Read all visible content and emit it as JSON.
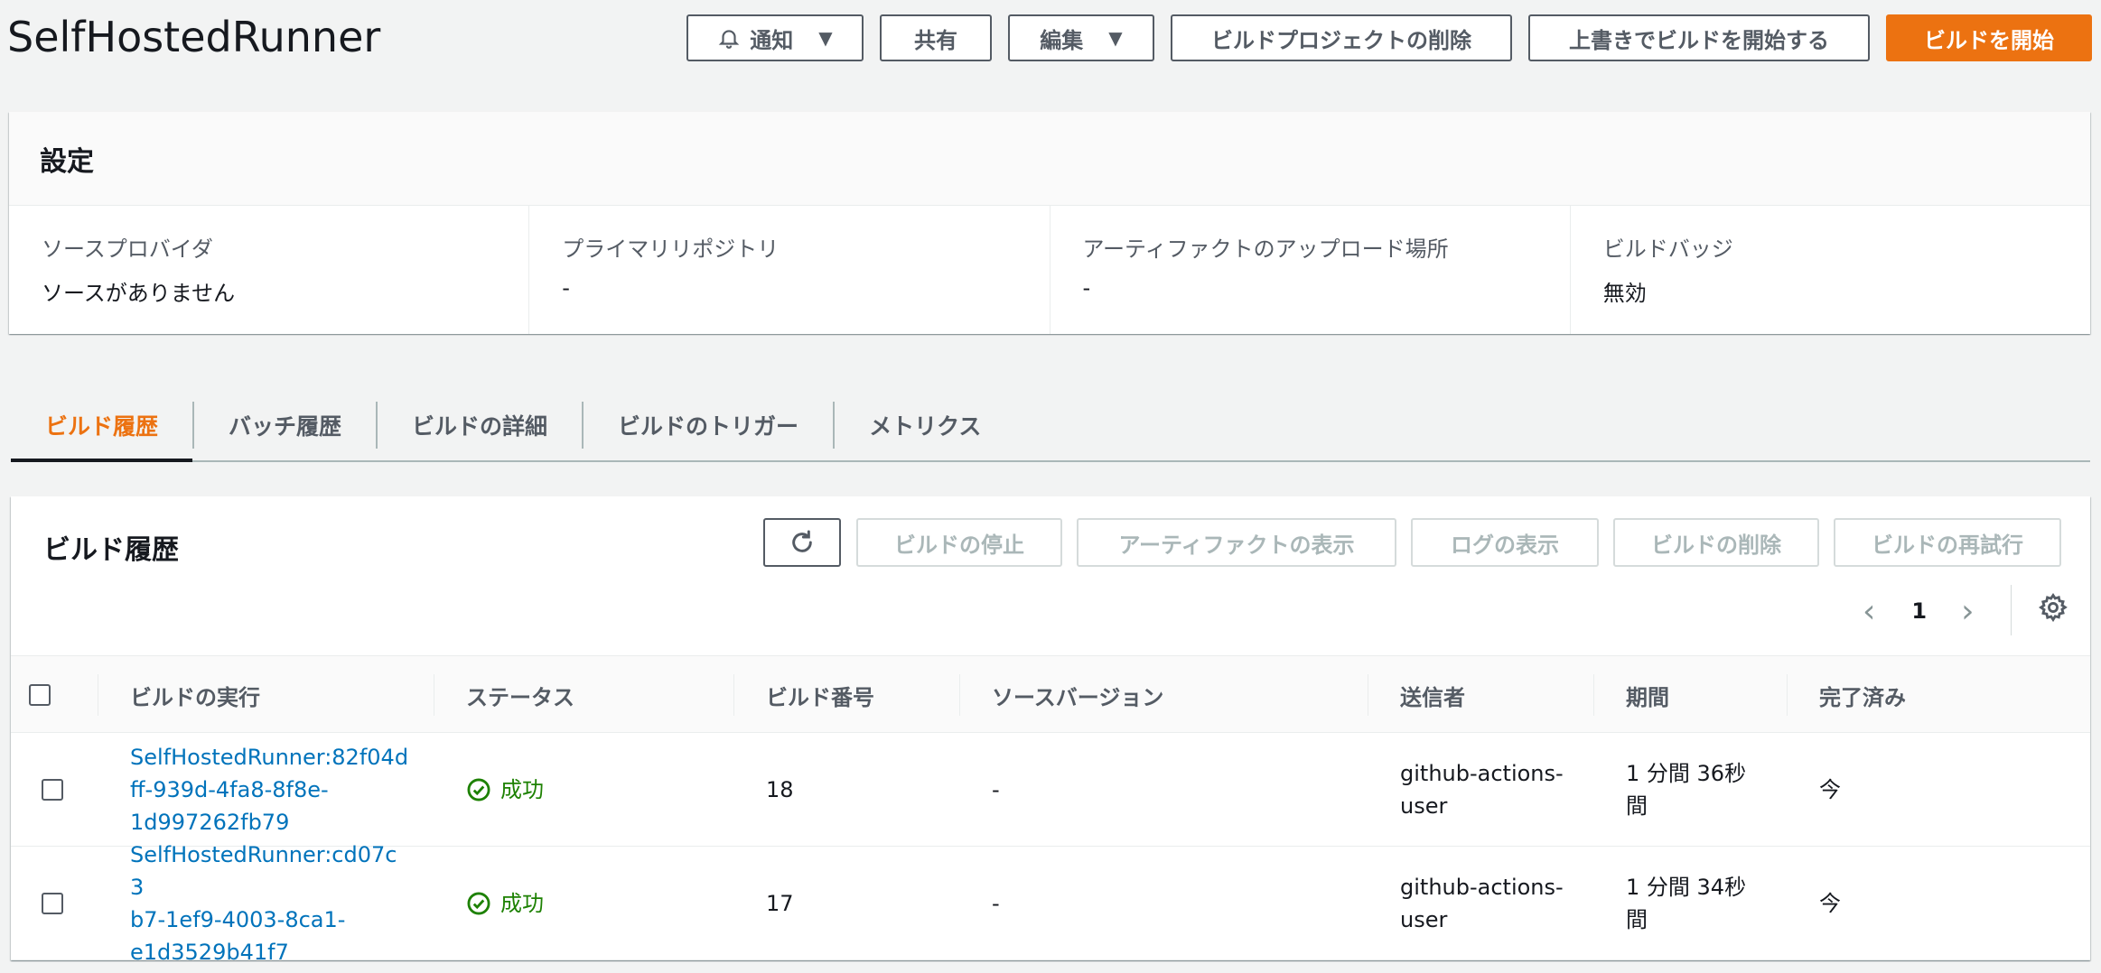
{
  "header": {
    "title": "SelfHostedRunner",
    "buttons": {
      "notify": "通知",
      "share": "共有",
      "edit": "編集",
      "delete_project": "ビルドプロジェクトの削除",
      "start_override": "上書きでビルドを開始する",
      "start_build": "ビルドを開始"
    }
  },
  "settings": {
    "title": "設定",
    "fields": [
      {
        "label": "ソースプロバイダ",
        "value": "ソースがありません"
      },
      {
        "label": "プライマリリポジトリ",
        "value": "-"
      },
      {
        "label": "アーティファクトのアップロード場所",
        "value": "-"
      },
      {
        "label": "ビルドバッジ",
        "value": "無効"
      }
    ]
  },
  "tabs": [
    "ビルド履歴",
    "バッチ履歴",
    "ビルドの詳細",
    "ビルドのトリガー",
    "メトリクス"
  ],
  "history": {
    "title": "ビルド履歴",
    "actions": {
      "stop": "ビルドの停止",
      "artifacts": "アーティファクトの表示",
      "logs": "ログの表示",
      "delete": "ビルドの削除",
      "retry": "ビルドの再試行"
    },
    "page": "1",
    "columns": [
      "ビルドの実行",
      "ステータス",
      "ビルド番号",
      "ソースバージョン",
      "送信者",
      "期間",
      "完了済み"
    ],
    "rows": [
      {
        "run_l1": "SelfHostedRunner:82f04d",
        "run_l2": "ff-939d-4fa8-8f8e-",
        "run_l3": "1d997262fb79",
        "status": "成功",
        "number": "18",
        "source_version": "-",
        "submitter_l1": "github-actions-",
        "submitter_l2": "user",
        "duration_l1": "1 分間 36秒",
        "duration_l2": "間",
        "completed": "今"
      },
      {
        "run_l1": "SelfHostedRunner:cd07c3",
        "run_l2": "b7-1ef9-4003-8ca1-",
        "run_l3": "e1d3529b41f7",
        "status": "成功",
        "number": "17",
        "source_version": "-",
        "submitter_l1": "github-actions-",
        "submitter_l2": "user",
        "duration_l1": "1 分間 34秒",
        "duration_l2": "間",
        "completed": "今"
      }
    ]
  }
}
